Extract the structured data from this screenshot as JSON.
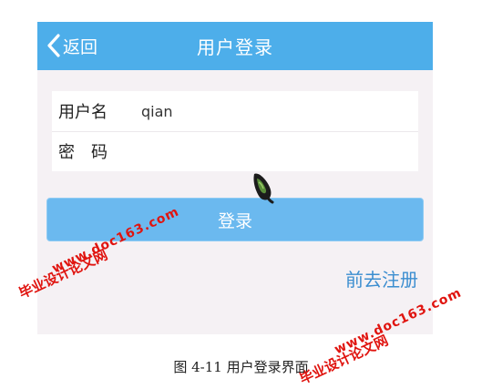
{
  "header": {
    "back_label": "返回",
    "title": "用户登录"
  },
  "form": {
    "username_label": "用户名",
    "username_value": "qian",
    "password_label": "密码",
    "password_value": ""
  },
  "login_label": "登录",
  "register_label": "前去注册",
  "caption": "图 4-11 用户登录界面",
  "watermarks": {
    "left_cn": "毕业设计论文网",
    "left_url": "www.doc163.com",
    "right_cn": "毕业设计论文网",
    "right_url": "www.doc163.com"
  },
  "colors": {
    "header": "#4daeea",
    "button": "#6bb9ef",
    "link": "#3c8ed0",
    "background": "#f5f1f4",
    "watermark": "#e0140f"
  }
}
